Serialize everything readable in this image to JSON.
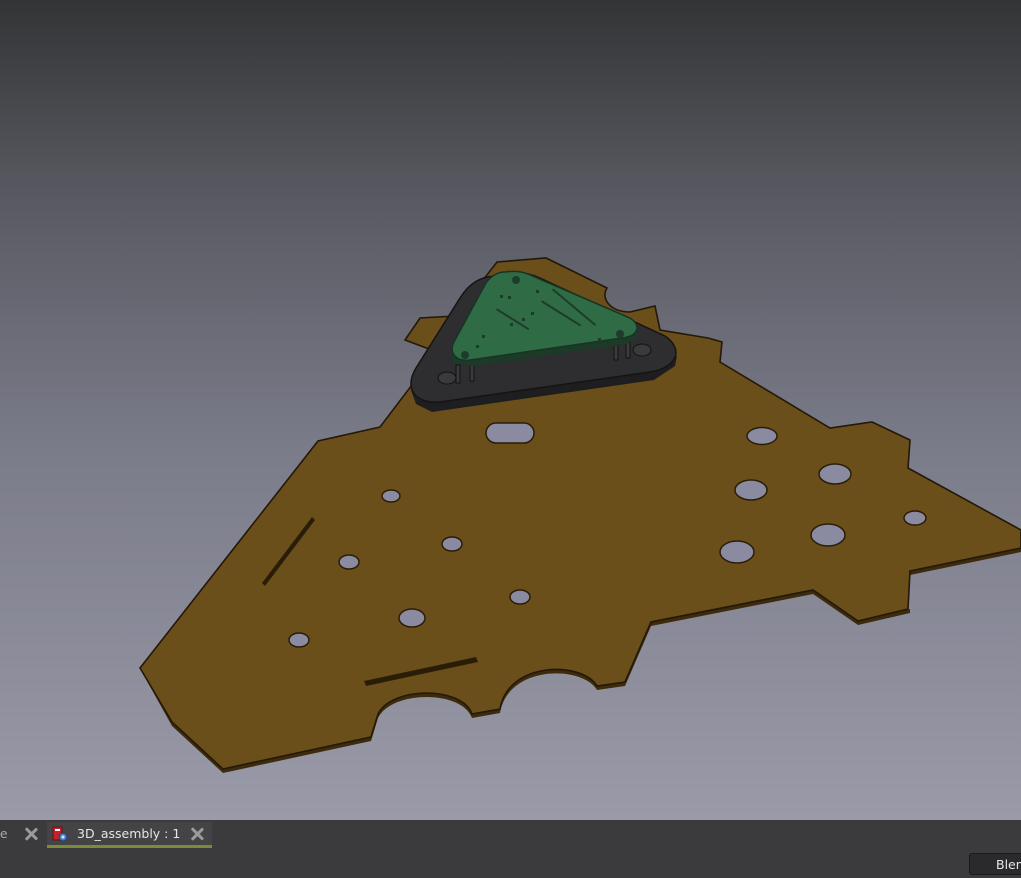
{
  "app": {
    "viewport": {
      "scene": "3D assembly: brown chassis plate with green triangular PCB on a dark mount",
      "colors": {
        "plate": "#6b4f1b",
        "plate_edge": "#4a3410",
        "pcb": "#2f6b45",
        "mount": "#2e2e30",
        "background_top": "#333436",
        "background_bottom": "#9a9aa9"
      }
    },
    "tabs": [
      {
        "label": "ge",
        "active": false
      },
      {
        "label": "3D_assembly : 1",
        "active": true,
        "icon": "freecad-document-icon"
      }
    ],
    "statusbar": {
      "navigation_style_label": "Blender"
    }
  }
}
